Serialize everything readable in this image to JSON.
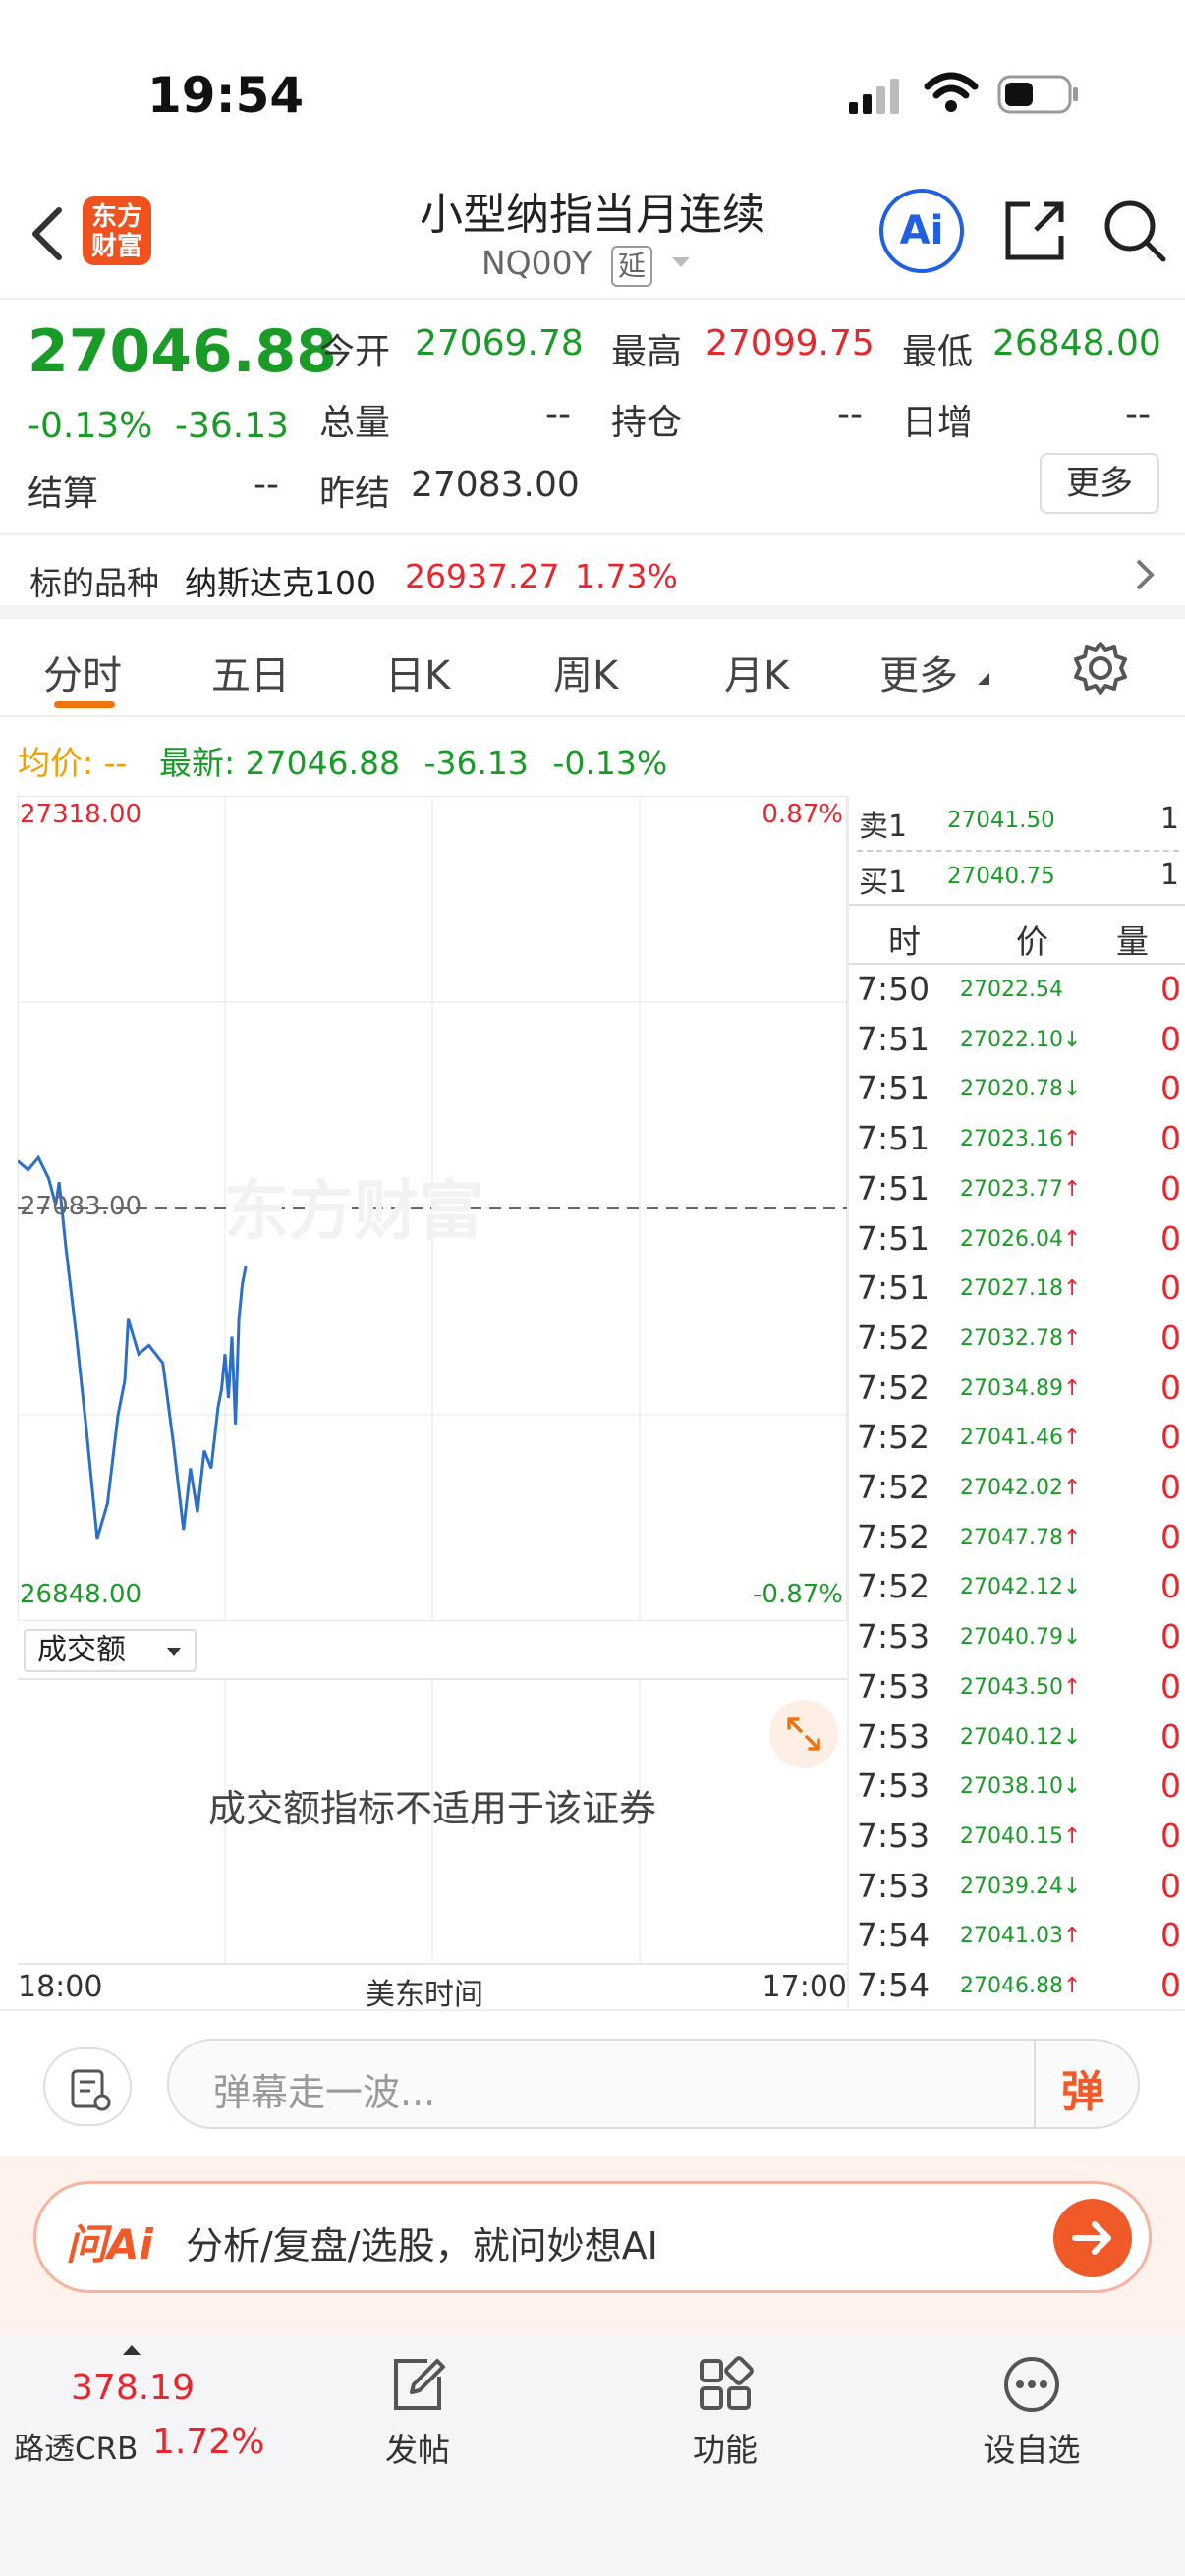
{
  "status": {
    "time": "19:54"
  },
  "nav": {
    "logo": "东方财富",
    "title": "小型纳指当月连续",
    "code": "NQ00Y",
    "delay_badge": "延",
    "ai_label": "Ai"
  },
  "quote": {
    "price": "27046.88",
    "pct": "-0.13%",
    "chg": "-36.13",
    "open_label": "今开",
    "open": "27069.78",
    "high_label": "最高",
    "high": "27099.75",
    "low_label": "最低",
    "low": "26848.00",
    "vol_label": "总量",
    "vol": "--",
    "oi_label": "持仓",
    "oi": "--",
    "inc_label": "日增",
    "inc": "--",
    "settle_label": "结算",
    "settle": "--",
    "prev_label": "昨结",
    "prev": "27083.00",
    "more": "更多"
  },
  "underlying": {
    "label": "标的品种",
    "name": "纳斯达克100",
    "price": "26937.27",
    "pct": "1.73%"
  },
  "tabs": [
    {
      "label": "分时"
    },
    {
      "label": "五日"
    },
    {
      "label": "日K"
    },
    {
      "label": "周K"
    },
    {
      "label": "月K"
    },
    {
      "label": "更多"
    }
  ],
  "avg": {
    "label": "均价:",
    "value": "--",
    "latest_label": "最新:",
    "latest": "27046.88",
    "chg": "-36.13",
    "pct": "-0.13%"
  },
  "chart": {
    "top": "27318.00",
    "bottom": "26848.00",
    "top_pct": "0.87%",
    "bottom_pct": "-0.87%",
    "mid": "27083.00",
    "watermark": "东方财富"
  },
  "chart_data": {
    "type": "line",
    "title": "",
    "ylim": [
      26848.0,
      27318.0
    ],
    "x": [
      0,
      3,
      6,
      9,
      11,
      12,
      14,
      17,
      20,
      23,
      26,
      29,
      31,
      32,
      35,
      38,
      42,
      45,
      48,
      50,
      52,
      54,
      56,
      58,
      59,
      60,
      61,
      62,
      63,
      64,
      65,
      66
    ],
    "series": [
      {
        "name": "",
        "values": [
          27110,
          27105,
          27112,
          27100,
          27085,
          27098,
          27060,
          27010,
          26955,
          26895,
          26915,
          26965,
          26985,
          27020,
          27000,
          27005,
          26995,
          26950,
          26900,
          26935,
          26910,
          26945,
          26935,
          26970,
          26980,
          27000,
          26975,
          27010,
          26960,
          27020,
          27040,
          27050
        ]
      }
    ]
  },
  "vol": {
    "selector": "成交额",
    "msg": "成交额指标不适用于该证券"
  },
  "xaxis": {
    "start": "18:00",
    "mid": "美东时间",
    "end": "17:00"
  },
  "book": {
    "sell_label": "卖1",
    "sell_price": "27041.50",
    "sell_qty": "1",
    "buy_label": "买1",
    "buy_price": "27040.75",
    "buy_qty": "1",
    "h_time": "时",
    "h_price": "价",
    "h_qty": "量",
    "ticks": [
      {
        "t": "7:50",
        "p": "27022.54",
        "d": "",
        "q": "0"
      },
      {
        "t": "7:51",
        "p": "27022.10",
        "d": "↓",
        "q": "0"
      },
      {
        "t": "7:51",
        "p": "27020.78",
        "d": "↓",
        "q": "0"
      },
      {
        "t": "7:51",
        "p": "27023.16",
        "d": "↑",
        "q": "0"
      },
      {
        "t": "7:51",
        "p": "27023.77",
        "d": "↑",
        "q": "0"
      },
      {
        "t": "7:51",
        "p": "27026.04",
        "d": "↑",
        "q": "0"
      },
      {
        "t": "7:51",
        "p": "27027.18",
        "d": "↑",
        "q": "0"
      },
      {
        "t": "7:52",
        "p": "27032.78",
        "d": "↑",
        "q": "0"
      },
      {
        "t": "7:52",
        "p": "27034.89",
        "d": "↑",
        "q": "0"
      },
      {
        "t": "7:52",
        "p": "27041.46",
        "d": "↑",
        "q": "0"
      },
      {
        "t": "7:52",
        "p": "27042.02",
        "d": "↑",
        "q": "0"
      },
      {
        "t": "7:52",
        "p": "27047.78",
        "d": "↑",
        "q": "0"
      },
      {
        "t": "7:52",
        "p": "27042.12",
        "d": "↓",
        "q": "0"
      },
      {
        "t": "7:53",
        "p": "27040.79",
        "d": "↓",
        "q": "0"
      },
      {
        "t": "7:53",
        "p": "27043.50",
        "d": "↑",
        "q": "0"
      },
      {
        "t": "7:53",
        "p": "27040.12",
        "d": "↓",
        "q": "0"
      },
      {
        "t": "7:53",
        "p": "27038.10",
        "d": "↓",
        "q": "0"
      },
      {
        "t": "7:53",
        "p": "27040.15",
        "d": "↑",
        "q": "0"
      },
      {
        "t": "7:53",
        "p": "27039.24",
        "d": "↓",
        "q": "0"
      },
      {
        "t": "7:54",
        "p": "27041.03",
        "d": "↑",
        "q": "0"
      },
      {
        "t": "7:54",
        "p": "27046.88",
        "d": "↑",
        "q": "0"
      }
    ]
  },
  "comment": {
    "placeholder": "弹幕走一波...",
    "dan": "弹"
  },
  "ai": {
    "logo": "问Ai",
    "text": "分析/复盘/选股，就问妙想AI"
  },
  "bottom": {
    "ticker_price": "378.19",
    "ticker_name": "路透CRB",
    "ticker_pct": "1.72%",
    "post": "发帖",
    "func": "功能",
    "watch": "设自选"
  }
}
